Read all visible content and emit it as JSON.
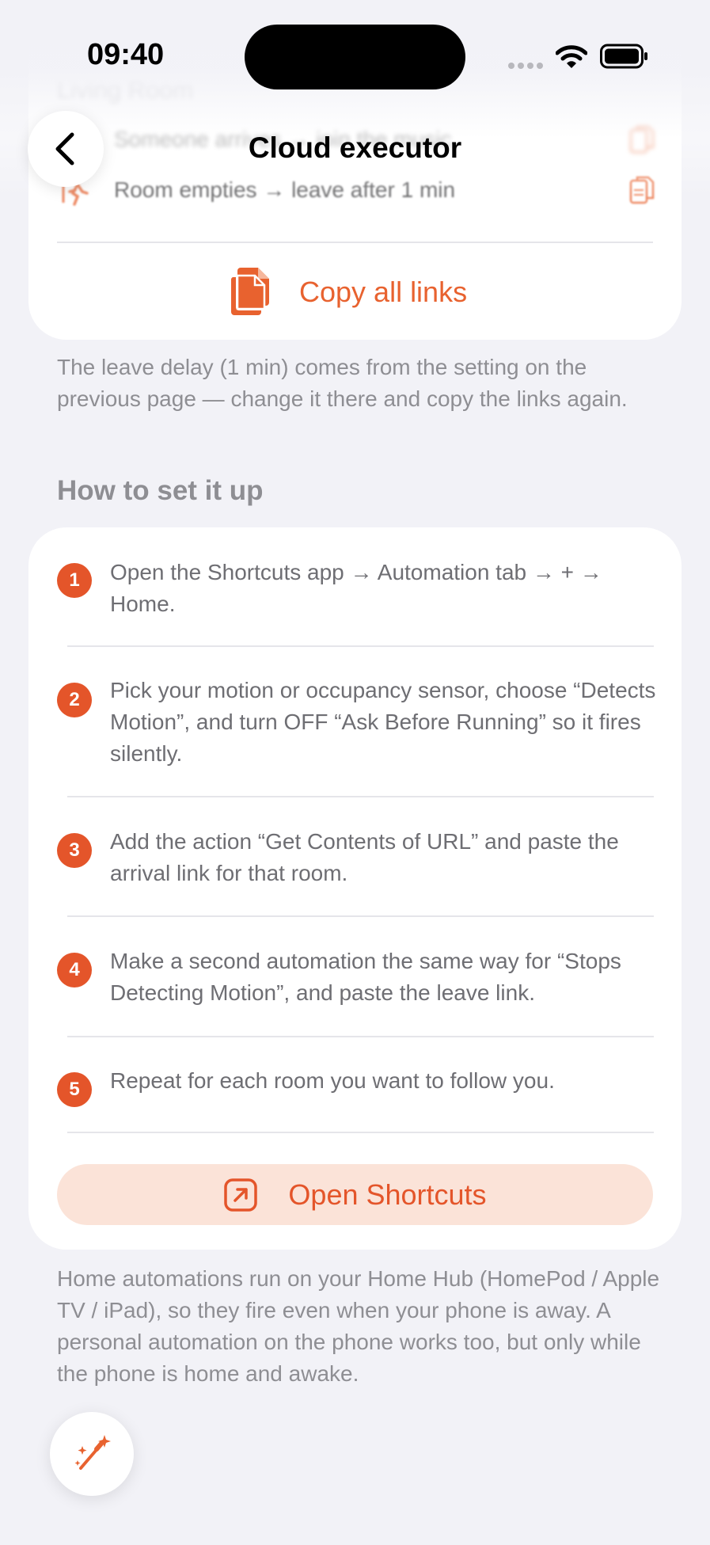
{
  "status_bar": {
    "time": "09:40"
  },
  "nav": {
    "title": "Cloud executor",
    "back_icon": "chevron-left-icon"
  },
  "links_card": {
    "section_label": "Living Room",
    "rows": [
      {
        "text": "Someone arrives → join the music",
        "icon": "person-walking-icon",
        "copy_icon": "copy-icon"
      },
      {
        "text": "Room empties → leave after 1 min",
        "icon": "person-walking-icon",
        "copy_icon": "copy-icon"
      }
    ],
    "copy_all_label": "Copy all links"
  },
  "leave_note": "The leave delay (1 min) comes from the setting on the previous page — change it there and copy the links again.",
  "setup": {
    "title": "How to set it up",
    "steps": [
      {
        "number": "1",
        "text": "Open the Shortcuts app → Automation tab → + → Home."
      },
      {
        "number": "2",
        "text": "Pick your motion or occupancy sensor, choose “Detects Motion”, and turn OFF “Ask Before Running” so it fires silently."
      },
      {
        "number": "3",
        "text": "Add the action “Get Contents of URL” and paste the arrival link for that room."
      },
      {
        "number": "4",
        "text": "Make a second automation the same way for “Stops Detecting Motion”, and paste the leave link."
      },
      {
        "number": "5",
        "text": "Repeat for each room you want to follow you."
      }
    ],
    "open_button_label": "Open Shortcuts"
  },
  "hub_note": "Home automations run on your Home Hub (HomePod / Apple TV / iPad), so they fire even when your phone is away. A personal automation on the phone works too, but only while the phone is home and awake.",
  "fab": {
    "icon": "magic-wand-icon"
  },
  "colors": {
    "accent": "#E4552A",
    "accent_soft": "#FBE3D8",
    "background": "#F2F2F7",
    "secondary_text": "#8E8E93"
  }
}
